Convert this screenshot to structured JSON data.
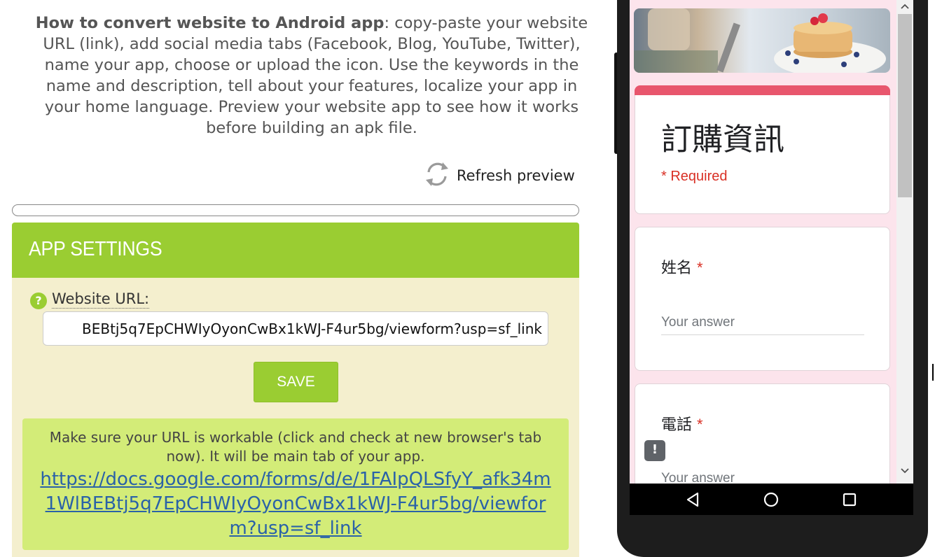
{
  "intro": {
    "bold": "How to convert website to Android app",
    "text": ": copy-paste your website URL (link), add social media tabs (Facebook, Blog, YouTube, Twitter), name your app, choose or upload the icon. Use the keywords in the name and description, tell about your features, localize your app in your home language. Preview your website app to see how it works before building an apk file."
  },
  "refresh": {
    "label": "Refresh preview"
  },
  "settings": {
    "title": "APP SETTINGS",
    "url_label": "Website URL:",
    "url_value": "BEBtj5q7EpCHWIyOyonCwBx1kWJ-F4ur5bg/viewform?usp=sf_link",
    "save_label": "SAVE",
    "notice": "Make sure your URL is workable (click and check at new browser's tab now). It will be main tab of your app.",
    "link": "https://docs.google.com/forms/d/e/1FAIpQLSfyY_afk34m1WlBEBtj5q7EpCHWIyOyonCwBx1kWJ-F4ur5bg/viewform?usp=sf_link"
  },
  "preview": {
    "form_title": "訂購資訊",
    "required": "* Required",
    "questions": [
      {
        "label": "姓名",
        "star": "*",
        "placeholder": "Your answer"
      },
      {
        "label": "電話",
        "star": "*",
        "placeholder": "Your answer"
      }
    ],
    "feedback_glyph": "!",
    "accent": "#e8566d"
  },
  "colors": {
    "brand_green": "#9acd32",
    "panel_bg": "#f4efce",
    "notice_bg": "#d3ec78",
    "link": "#2a62a8"
  }
}
